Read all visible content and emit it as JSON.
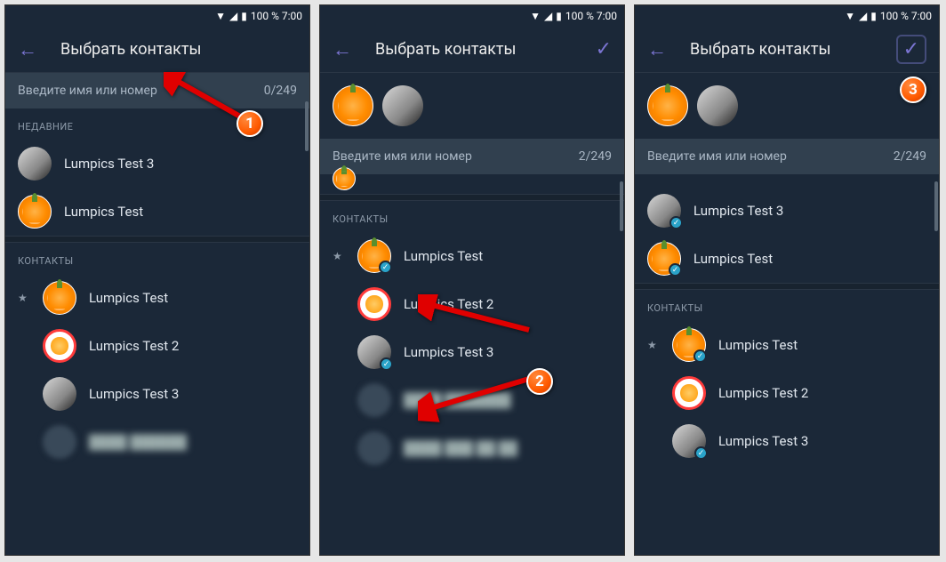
{
  "status": {
    "battery_text": "100 % 7:00"
  },
  "appbar": {
    "title": "Выбрать контакты"
  },
  "search": {
    "placeholder": "Введите имя или номер"
  },
  "sections": {
    "recent": "НЕДАВНИЕ",
    "contacts": "КОНТАКТЫ"
  },
  "names": {
    "lumpics_test": "Lumpics Test",
    "lumpics_test_2": "Lumpics Test 2",
    "lumpics_test_3": "Lumpics Test 3"
  },
  "counters": {
    "screen1": "0/249",
    "screen2": "2/249",
    "screen3": "2/249"
  },
  "callouts": {
    "one": "1",
    "two": "2",
    "three": "3"
  }
}
